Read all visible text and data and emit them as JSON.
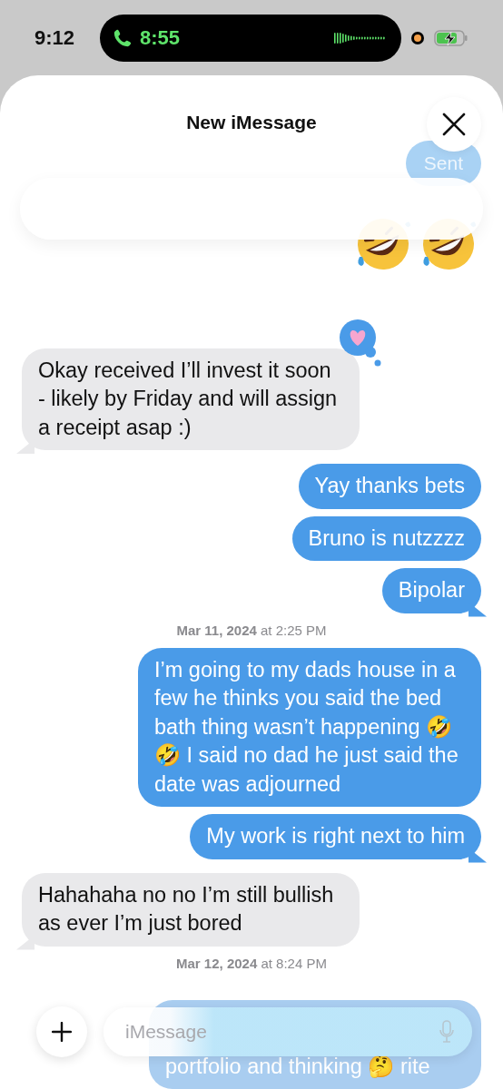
{
  "status_bar": {
    "time": "9:12",
    "call_time": "8:55"
  },
  "header": {
    "title": "New iMessage"
  },
  "behind_header": {
    "sent_label": "Sent"
  },
  "messages": [
    {
      "kind": "received",
      "text": "Okay received I’ll invest it soon - likely by Friday and will assign a receipt asap :)",
      "heart_reaction": true,
      "tail": true
    },
    {
      "kind": "sent",
      "text": "Yay thanks bets",
      "tail": false
    },
    {
      "kind": "sent",
      "text": "Bruno is nutzzzz",
      "tail": false
    },
    {
      "kind": "sent",
      "text": "Bipolar",
      "tail": true
    },
    {
      "kind": "timestamp",
      "text": "**Mar 11, 2024** at 2:25 PM"
    },
    {
      "kind": "sent",
      "text": "I’m going to my dads house in a few he thinks you said the bed bath thing wasn’t happening 🤣 🤣 I said no dad he just said the date was adjourned",
      "tail": false
    },
    {
      "kind": "sent",
      "text": "My work is right next to him",
      "tail": true
    },
    {
      "kind": "received",
      "text": "Hahahaha no no I’m still bullish as ever I’m just bored",
      "tail": true
    },
    {
      "kind": "timestamp",
      "text": "**Mar 12, 2024** at 8:24 PM"
    },
    {
      "kind": "sent_partial",
      "text": "portfolio and thinking 🤔 rite"
    }
  ],
  "composer": {
    "placeholder": "iMessage"
  }
}
